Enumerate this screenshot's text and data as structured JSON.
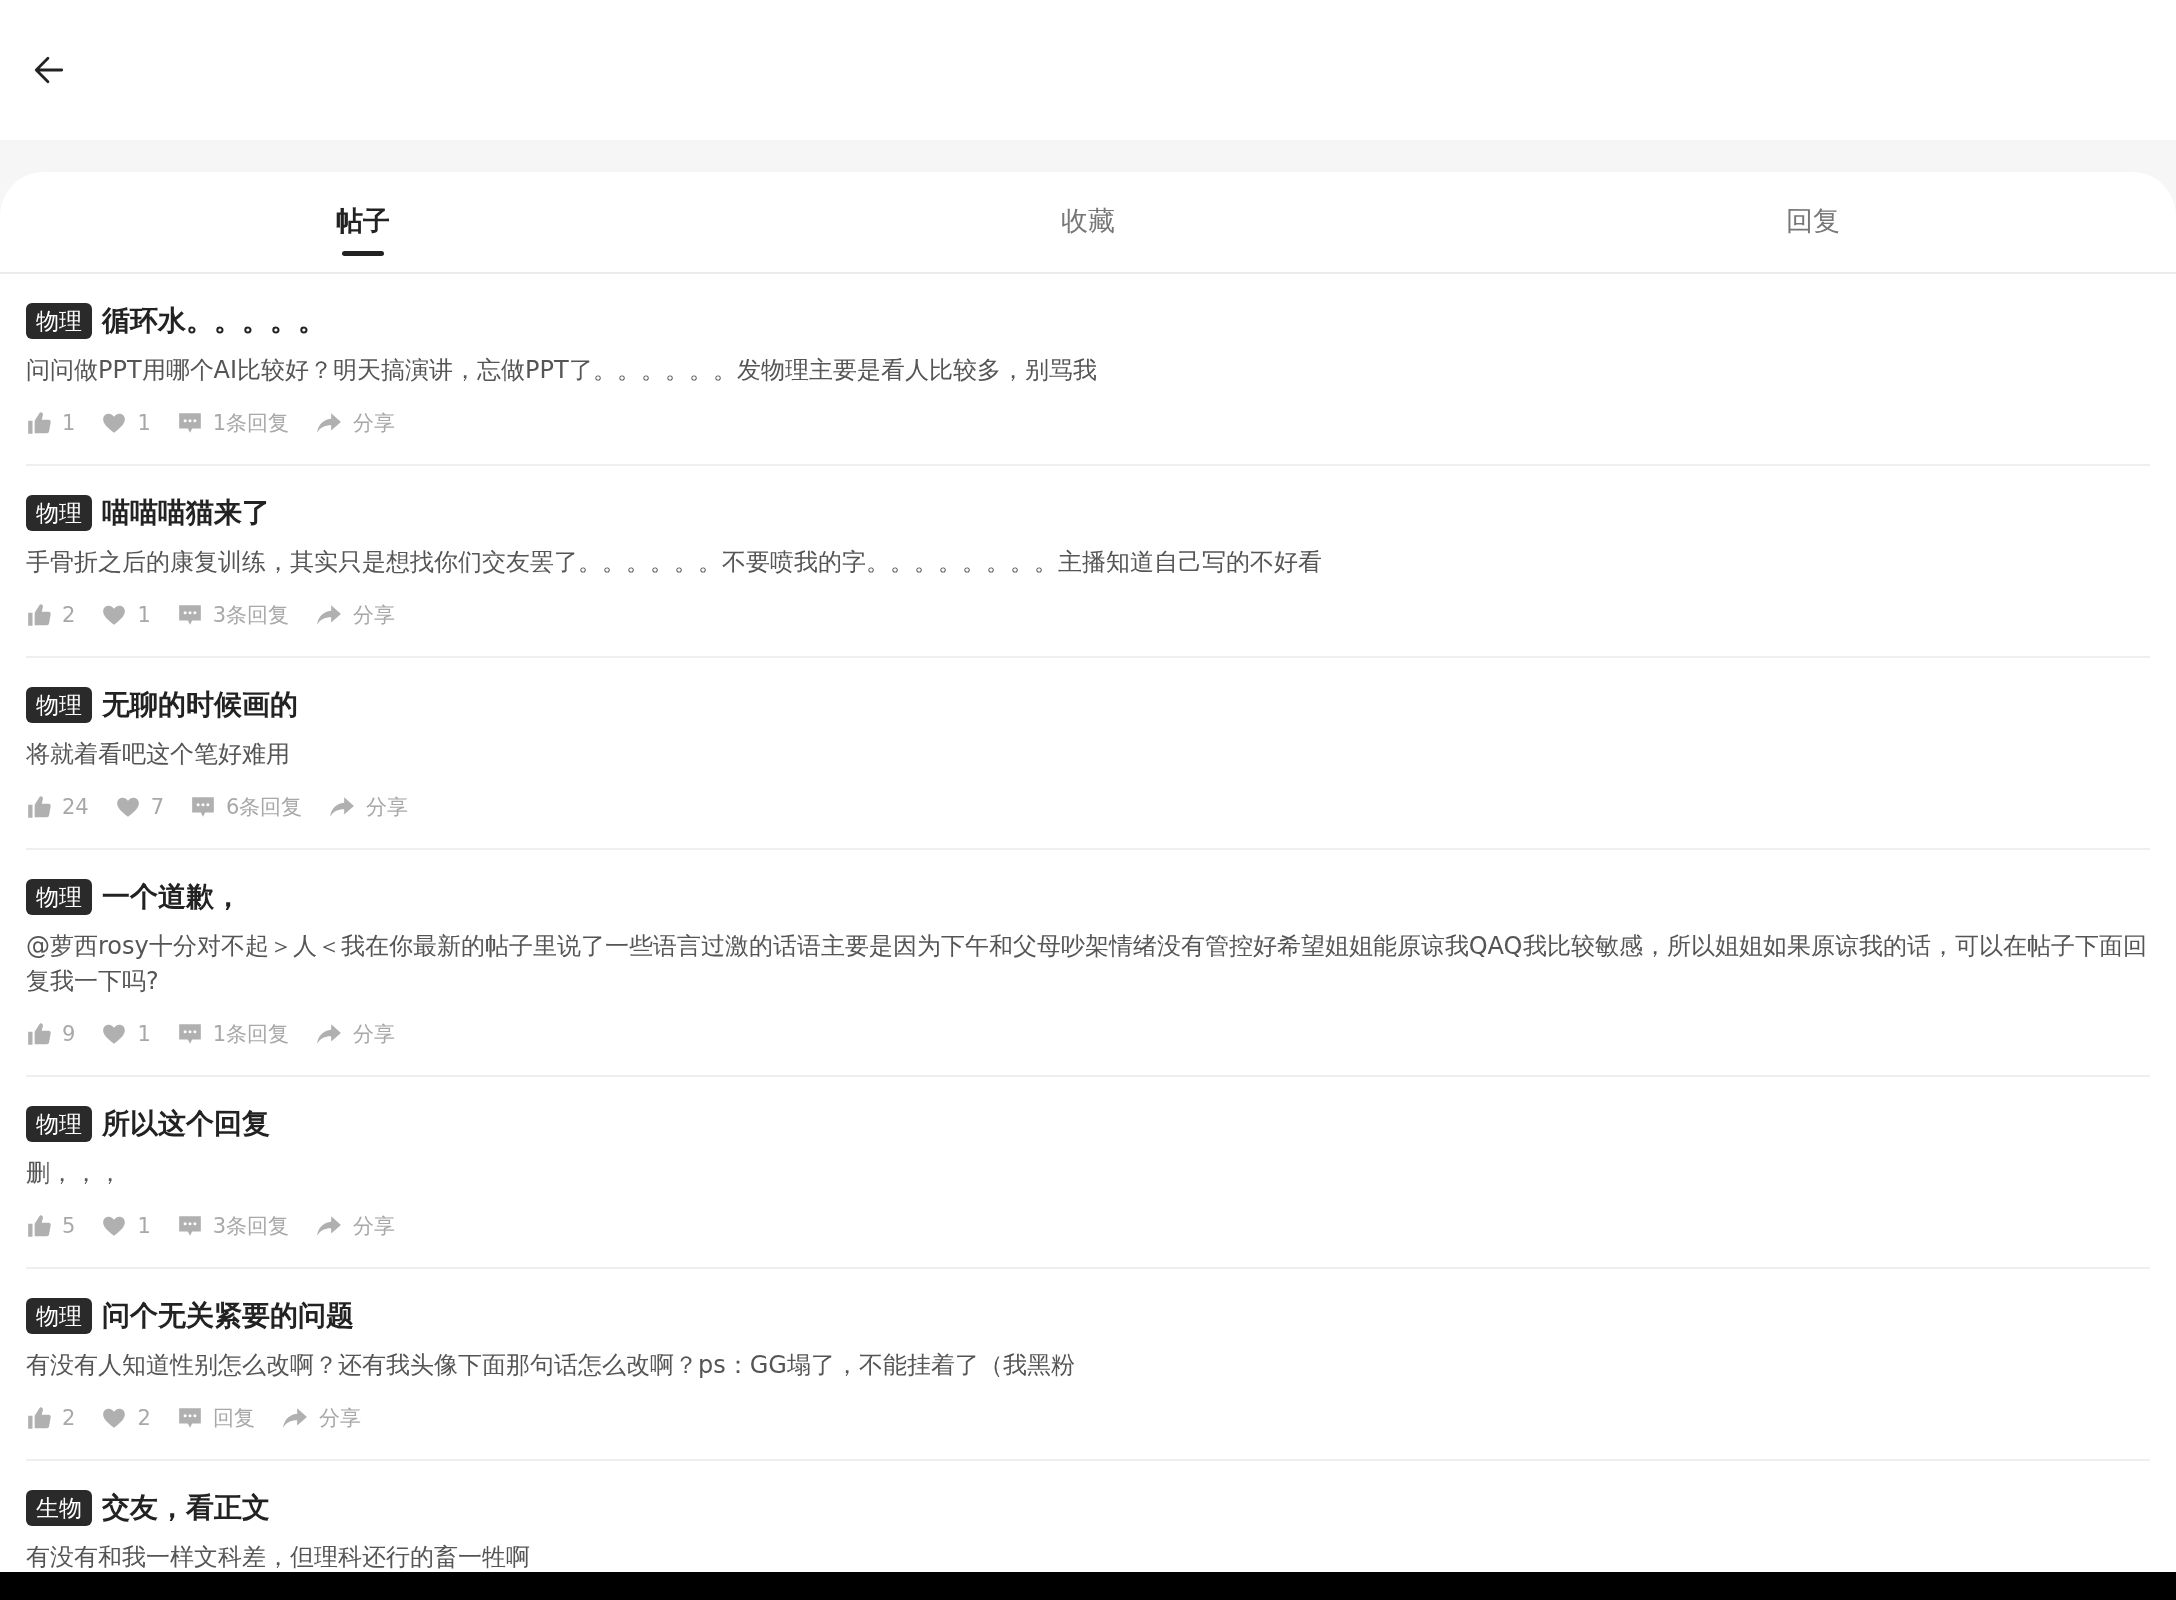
{
  "tabs": [
    {
      "label": "帖子",
      "selected": true
    },
    {
      "label": "收藏",
      "selected": false
    },
    {
      "label": "回复",
      "selected": false
    }
  ],
  "posts": [
    {
      "tag": "物理",
      "title": "循环水。。。。。",
      "body": "问问做PPT用哪个AI比较好？明天搞演讲，忘做PPT了。。。。。。发物理主要是看人比较多，别骂我",
      "likes": "1",
      "favorites": "1",
      "replies": "1条回复",
      "share": "分享"
    },
    {
      "tag": "物理",
      "title": "喵喵喵猫来了",
      "body": "手骨折之后的康复训练，其实只是想找你们交友罢了。。。。。。不要喷我的字。。。。。。。。主播知道自己写的不好看",
      "likes": "2",
      "favorites": "1",
      "replies": "3条回复",
      "share": "分享"
    },
    {
      "tag": "物理",
      "title": "无聊的时候画的",
      "body": "将就着看吧这个笔好难用",
      "likes": "24",
      "favorites": "7",
      "replies": "6条回复",
      "share": "分享"
    },
    {
      "tag": "物理",
      "title": "一个道歉，",
      "body": "@萝西rosy十分对不起＞人＜我在你最新的帖子里说了一些语言过激的话语主要是因为下午和父母吵架情绪没有管控好希望姐姐能原谅我QAQ我比较敏感，所以姐姐如果原谅我的话，可以在帖子下面回复我一下吗?",
      "likes": "9",
      "favorites": "1",
      "replies": "1条回复",
      "share": "分享"
    },
    {
      "tag": "物理",
      "title": "所以这个回复",
      "body": "删，，，",
      "likes": "5",
      "favorites": "1",
      "replies": "3条回复",
      "share": "分享"
    },
    {
      "tag": "物理",
      "title": "问个无关紧要的问题",
      "body": "有没有人知道性别怎么改啊？还有我头像下面那句话怎么改啊？ps：GG塌了，不能挂着了（我黑粉",
      "likes": "2",
      "favorites": "2",
      "replies": "回复",
      "share": "分享"
    },
    {
      "tag": "生物",
      "title": "交友，看正文",
      "body": "有没有和我一样文科差，但理科还行的畜一牲啊"
    }
  ]
}
